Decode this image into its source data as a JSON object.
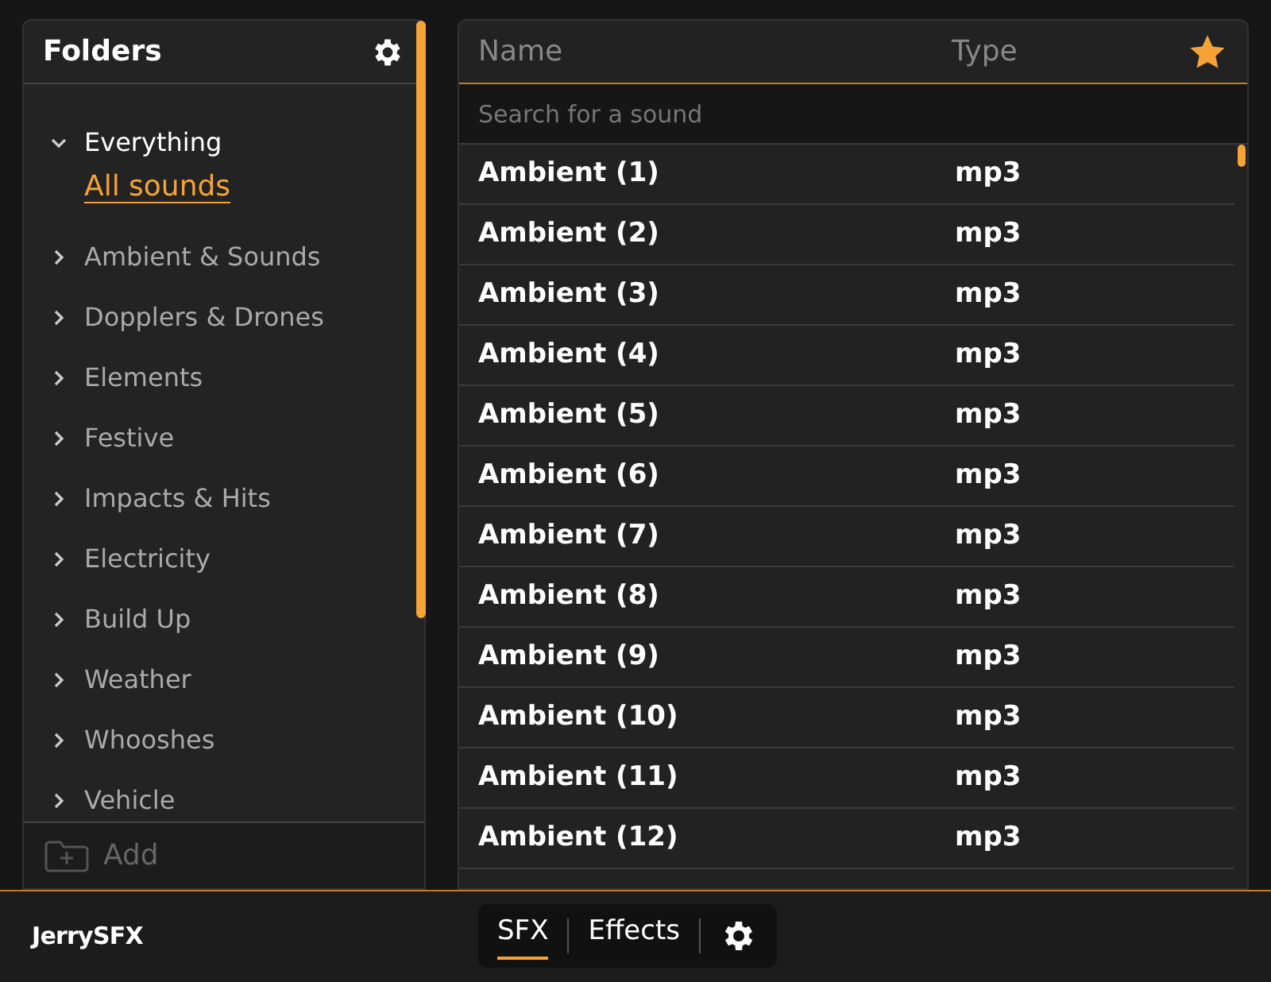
{
  "sidebar": {
    "title": "Folders",
    "items": [
      {
        "label": "Everything",
        "expanded": true,
        "children": [
          {
            "label": "All sounds",
            "selected": true
          }
        ]
      },
      {
        "label": "Ambient & Sounds",
        "expanded": false
      },
      {
        "label": "Dopplers & Drones",
        "expanded": false
      },
      {
        "label": "Elements",
        "expanded": false
      },
      {
        "label": "Festive",
        "expanded": false
      },
      {
        "label": "Impacts & Hits",
        "expanded": false
      },
      {
        "label": "Electricity",
        "expanded": false
      },
      {
        "label": "Build Up",
        "expanded": false
      },
      {
        "label": "Weather",
        "expanded": false
      },
      {
        "label": "Whooshes",
        "expanded": false
      },
      {
        "label": "Vehicle",
        "expanded": false
      }
    ],
    "add_label": "Add"
  },
  "table": {
    "columns": [
      "Name",
      "Type"
    ],
    "search": {
      "placeholder": "Search for a sound"
    },
    "rows": [
      {
        "name": "Ambient (1)",
        "type": "mp3"
      },
      {
        "name": "Ambient (2)",
        "type": "mp3"
      },
      {
        "name": "Ambient (3)",
        "type": "mp3"
      },
      {
        "name": "Ambient (4)",
        "type": "mp3"
      },
      {
        "name": "Ambient (5)",
        "type": "mp3"
      },
      {
        "name": "Ambient (6)",
        "type": "mp3"
      },
      {
        "name": "Ambient (7)",
        "type": "mp3"
      },
      {
        "name": "Ambient (8)",
        "type": "mp3"
      },
      {
        "name": "Ambient (9)",
        "type": "mp3"
      },
      {
        "name": "Ambient (10)",
        "type": "mp3"
      },
      {
        "name": "Ambient (11)",
        "type": "mp3"
      },
      {
        "name": "Ambient (12)",
        "type": "mp3"
      }
    ]
  },
  "footer": {
    "brand": "JerrySFX",
    "tabs": [
      {
        "label": "SFX",
        "selected": true
      },
      {
        "label": "Effects",
        "selected": false
      }
    ]
  }
}
